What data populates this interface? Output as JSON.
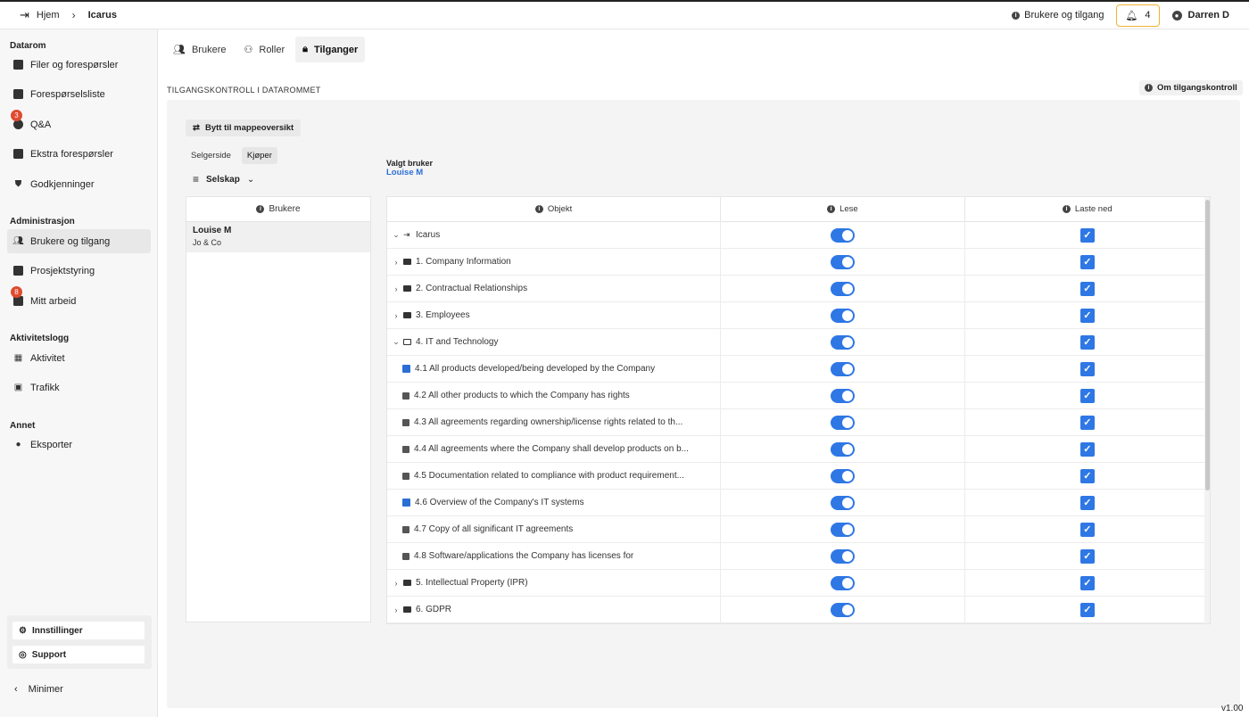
{
  "topbar": {
    "home_label": "Hjem",
    "project": "Icarus",
    "users_access_link": "Brukere og tilgang",
    "notifications_count": "4",
    "user_name": "Darren D"
  },
  "sidebar": {
    "sections": {
      "datarom": "Datarom",
      "administrasjon": "Administrasjon",
      "aktivitetslogg": "Aktivitetslogg",
      "annet": "Annet"
    },
    "items": {
      "files": "Filer og forespørsler",
      "requests": "Forespørselsliste",
      "qa": "Q&A",
      "qa_badge": "3",
      "extra": "Ekstra forespørsler",
      "approvals": "Godkjenninger",
      "users": "Brukere og tilgang",
      "project": "Prosjektstyring",
      "mywork": "Mitt arbeid",
      "mywork_badge": "8",
      "activity": "Aktivitet",
      "traffic": "Trafikk",
      "export": "Eksporter"
    },
    "settings": "Innstillinger",
    "support": "Support",
    "minimize": "Minimer"
  },
  "tabs": {
    "users": "Brukere",
    "roles": "Roller",
    "access": "Tilganger"
  },
  "section_label": "TILGANGSKONTROLL I DATAROMMET",
  "about_btn": "Om tilgangskontroll",
  "switch_btn": "Bytt til mappeoversikt",
  "side_tabs": {
    "seller": "Selgerside",
    "buyer": "Kjøper"
  },
  "filter_label": "Selskap",
  "chosen": {
    "label": "Valgt bruker",
    "user": "Louise M"
  },
  "users_panel": {
    "header": "Brukere",
    "user_name": "Louise M",
    "user_company": "Jo & Co"
  },
  "table": {
    "headers": {
      "object": "Objekt",
      "read": "Lese",
      "download": "Laste ned"
    },
    "rows": [
      {
        "label": "Icarus"
      },
      {
        "label": "1. Company Information"
      },
      {
        "label": "2. Contractual Relationships"
      },
      {
        "label": "3. Employees"
      },
      {
        "label": "4. IT and Technology"
      },
      {
        "label": "4.1 All products developed/being developed by the Company"
      },
      {
        "label": "4.2 All other products to which the Company has rights"
      },
      {
        "label": "4.3 All agreements regarding ownership/license rights related to th..."
      },
      {
        "label": "4.4 All agreements where the Company shall develop products on b..."
      },
      {
        "label": "4.5 Documentation related to compliance with product requirement..."
      },
      {
        "label": "4.6 Overview of the Company's IT systems"
      },
      {
        "label": "4.7 Copy of all significant IT agreements"
      },
      {
        "label": "4.8 Software/applications the Company has licenses for"
      },
      {
        "label": "5. Intellectual Property (IPR)"
      },
      {
        "label": "6. GDPR"
      }
    ]
  },
  "version": "v1.00"
}
